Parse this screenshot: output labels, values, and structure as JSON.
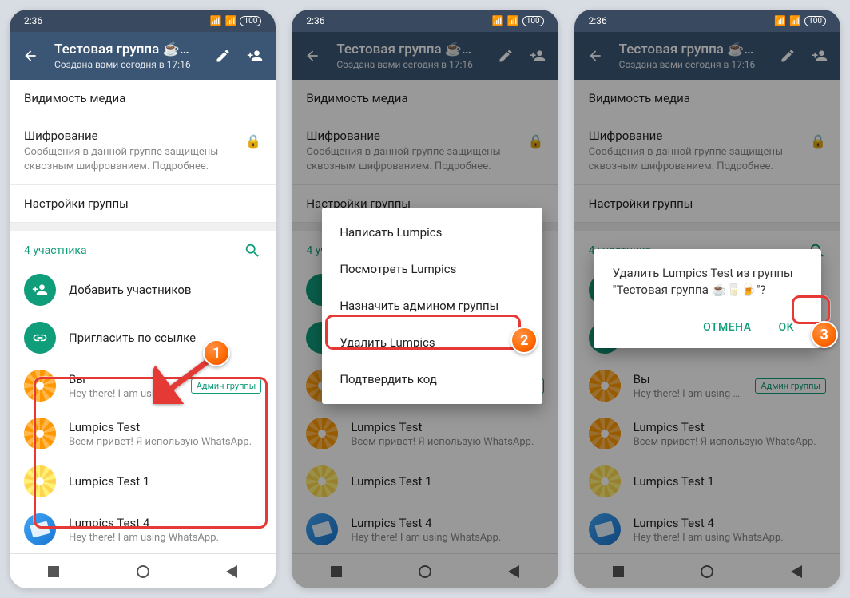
{
  "statusbar": {
    "time": "2:36",
    "battery": "100"
  },
  "header": {
    "title": "Тестовая группа ☕…",
    "subtitle": "Создана вами сегодня в 17:16"
  },
  "settings": {
    "media": "Видимость медиа",
    "encryption_title": "Шифрование",
    "encryption_sub": "Сообщения в данной группе защищены сквозным шифрованием. Подробнее.",
    "group_settings": "Настройки группы"
  },
  "participants": {
    "count_label": "4 участника",
    "add": "Добавить участников",
    "invite": "Пригласить по ссылке"
  },
  "members": [
    {
      "name": "Вы",
      "status": "Hey there! I am using WhatsApp.",
      "admin": "Админ группы"
    },
    {
      "name": "Lumpics Test",
      "status": "Всем привет! Я использую WhatsApp."
    },
    {
      "name": "Lumpics Test 1",
      "status": ""
    },
    {
      "name": "Lumpics Test 4",
      "status": "Hey there! I am using WhatsApp."
    }
  ],
  "popup": {
    "write": "Написать Lumpics",
    "view": "Посмотреть Lumpics",
    "make_admin": "Назначить админом группы",
    "remove": "Удалить Lumpics",
    "verify": "Подтвердить код"
  },
  "dialog": {
    "message": "Удалить Lumpics Test из группы \"Тестовая группа ☕🥛🍺\"?",
    "cancel": "ОТМЕНА",
    "ok": "OK"
  }
}
